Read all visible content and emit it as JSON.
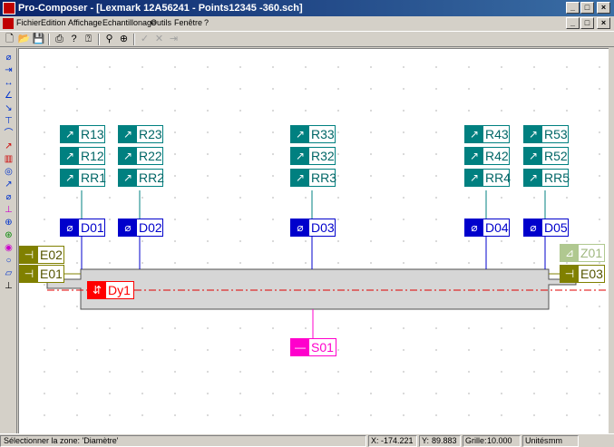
{
  "window": {
    "title": "Pro-Composer - [Lexmark 12A56241 - Points12345 -360.sch]",
    "controls": [
      "_",
      "□",
      "×"
    ]
  },
  "menu": {
    "items": [
      "Fichier",
      "Edition",
      "Affichage",
      "Echantillonage",
      "Outils",
      "Fenêtre",
      "?"
    ],
    "doc_controls": [
      "_",
      "□",
      "×"
    ]
  },
  "toolbar": {
    "buttons": [
      "new-icon",
      "open-icon",
      "save-icon",
      "print-icon",
      "help-icon",
      "context-help-icon",
      "zoom-icon",
      "zoom-in-icon",
      "check-icon",
      "cancel-icon",
      "next-icon"
    ]
  },
  "left_tools": [
    "diameter-icon",
    "position-icon",
    "distance-icon",
    "angle-icon",
    "slope-icon",
    "perpendicular-icon",
    "arc-icon",
    "runout-icon",
    "surface-icon",
    "circle-icon",
    "radius-icon",
    "diameter-icon",
    "height-icon",
    "center-icon",
    "concentric-icon",
    "profile-icon",
    "ellipse-icon",
    "line-icon",
    "reference-icon"
  ],
  "labels": {
    "radius": [
      [
        "R13",
        "R12",
        "RR1"
      ],
      [
        "R23",
        "R22",
        "RR2"
      ],
      [
        "R33",
        "R32",
        "RR3"
      ],
      [
        "R43",
        "R42",
        "RR4"
      ],
      [
        "R53",
        "R52",
        "RR5"
      ]
    ],
    "diameter": [
      "D01",
      "D02",
      "D03",
      "D04",
      "D05"
    ],
    "ends_left": [
      "E02",
      "E01"
    ],
    "ends_right": [
      "Z01",
      "E03"
    ],
    "dynamic": "Dy1",
    "section": "S01"
  },
  "colors": {
    "radius": "#008080",
    "diameter": "#0000cc",
    "ends": "#808000",
    "z": "#b0c890",
    "dynamic": "#ff0000",
    "section": "#ff00cc",
    "part": "#d6d6d6",
    "axis": "#e00000"
  },
  "status": {
    "message": "Sélectionner la zone: 'Diamètre'",
    "x_label": "X:",
    "x_value": "-174.221",
    "y_label": "Y:",
    "y_value": "89.883",
    "grid_label": "Grille:",
    "grid_value": "10.000",
    "units_label": "Unités:",
    "units_value": "mm"
  }
}
